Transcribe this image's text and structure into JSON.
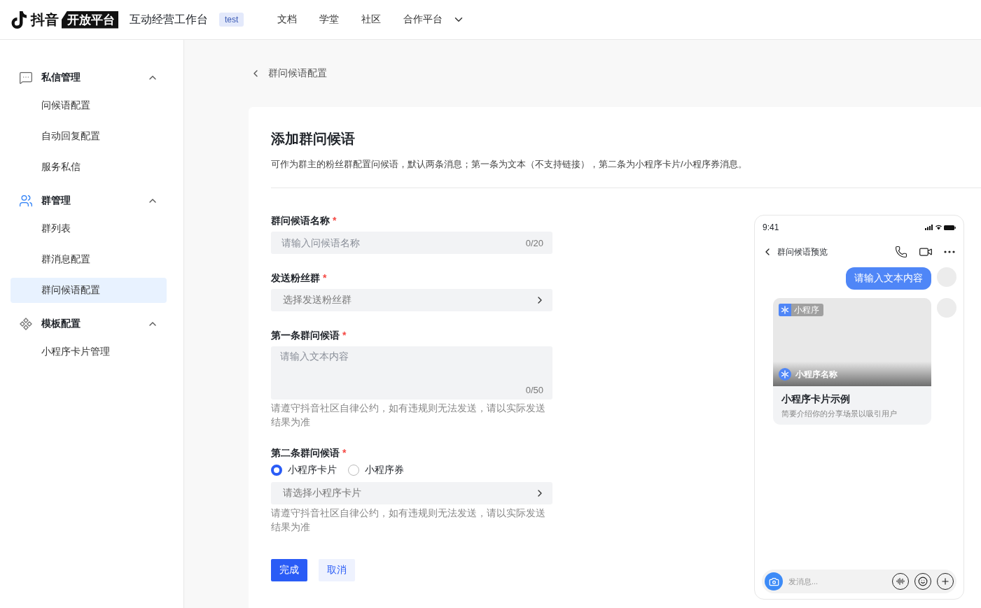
{
  "header": {
    "logo_text": "抖音",
    "logo_badge": "开放平台",
    "product": "互动经营工作台",
    "env_tag": "test",
    "nav": [
      {
        "label": "文档",
        "kind": "link"
      },
      {
        "label": "学堂",
        "kind": "link"
      },
      {
        "label": "社区",
        "kind": "link"
      },
      {
        "label": "合作平台",
        "kind": "dropdown"
      }
    ]
  },
  "sidebar": {
    "groups": [
      {
        "label": "私信管理",
        "expanded": true,
        "children": [
          {
            "label": "问候语配置",
            "selected": false
          },
          {
            "label": "自动回复配置",
            "selected": false
          },
          {
            "label": "服务私信",
            "selected": false
          }
        ]
      },
      {
        "label": "群管理",
        "expanded": true,
        "children": [
          {
            "label": "群列表",
            "selected": false
          },
          {
            "label": "群消息配置",
            "selected": false
          },
          {
            "label": "群问候语配置",
            "selected": true
          }
        ]
      },
      {
        "label": "模板配置",
        "expanded": true,
        "children": [
          {
            "label": "小程序卡片管理",
            "selected": false
          }
        ]
      }
    ]
  },
  "breadcrumb": "群问候语配置",
  "form": {
    "title": "添加群问候语",
    "description": "可作为群主的粉丝群配置问候语，默认两条消息；第一条为文本（不支持链接），第二条为小程序卡片/小程序券消息。",
    "fields": [
      {
        "kind": "input",
        "label": "群问候语名称",
        "required_mark": "*",
        "placeholder": "请输入问候语名称",
        "counter": "0/20"
      },
      {
        "kind": "select",
        "label": "发送粉丝群",
        "required_mark": "*",
        "placeholder": "选择发送粉丝群"
      },
      {
        "kind": "textarea",
        "label": "第一条群问候语",
        "required_mark": "*",
        "placeholder": "请输入文本内容",
        "counter": "0/50",
        "help": "请遵守抖音社区自律公约，如有违规则无法发送，请以实际发送结果为准"
      },
      {
        "kind": "radio-select",
        "label": "第二条群问候语",
        "required_mark": "*",
        "options": [
          {
            "label": "小程序卡片",
            "selected": true
          },
          {
            "label": "小程序券",
            "selected": false
          }
        ],
        "placeholder": "请选择小程序卡片",
        "help": "请遵守抖音社区自律公约，如有违规则无法发送，请以实际发送结果为准"
      }
    ],
    "buttons": [
      {
        "label": "完成",
        "kind": "primary"
      },
      {
        "label": "取消",
        "kind": "secondary"
      }
    ]
  },
  "preview": {
    "time": "9:41",
    "title": "群问候语预览",
    "message": "请输入文本内容",
    "card": {
      "tag": "小程序",
      "app_name": "小程序名称",
      "title": "小程序卡片示例",
      "description": "简要介绍你的分享场景以吸引用户"
    },
    "input_placeholder": "发消息..."
  }
}
